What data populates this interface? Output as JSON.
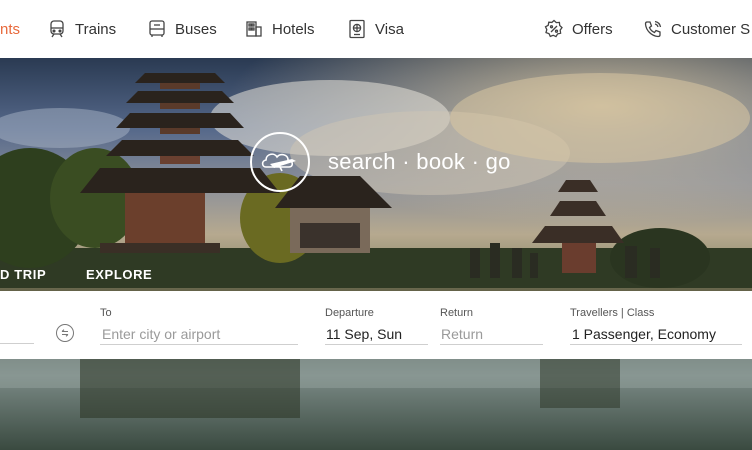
{
  "nav": {
    "items": [
      {
        "label": "nts",
        "icon": "flight-icon",
        "active": true
      },
      {
        "label": "Trains",
        "icon": "train-icon"
      },
      {
        "label": "Buses",
        "icon": "bus-icon"
      },
      {
        "label": "Hotels",
        "icon": "hotel-icon"
      },
      {
        "label": "Visa",
        "icon": "passport-icon"
      },
      {
        "label": "Offers",
        "icon": "offer-tag-icon"
      },
      {
        "label": "Customer S",
        "icon": "phone-support-icon"
      }
    ],
    "accent_color": "#e8693c"
  },
  "hero": {
    "tagline": "search · book · go",
    "tabs": [
      "D TRIP",
      "EXPLORE"
    ]
  },
  "search": {
    "to": {
      "label": "To",
      "placeholder": "Enter city or airport"
    },
    "departure": {
      "label": "Departure",
      "value": "11 Sep, Sun"
    },
    "return": {
      "label": "Return",
      "placeholder": "Return"
    },
    "travellers": {
      "label": "Travellers | Class",
      "value": "1 Passenger, Economy"
    }
  }
}
